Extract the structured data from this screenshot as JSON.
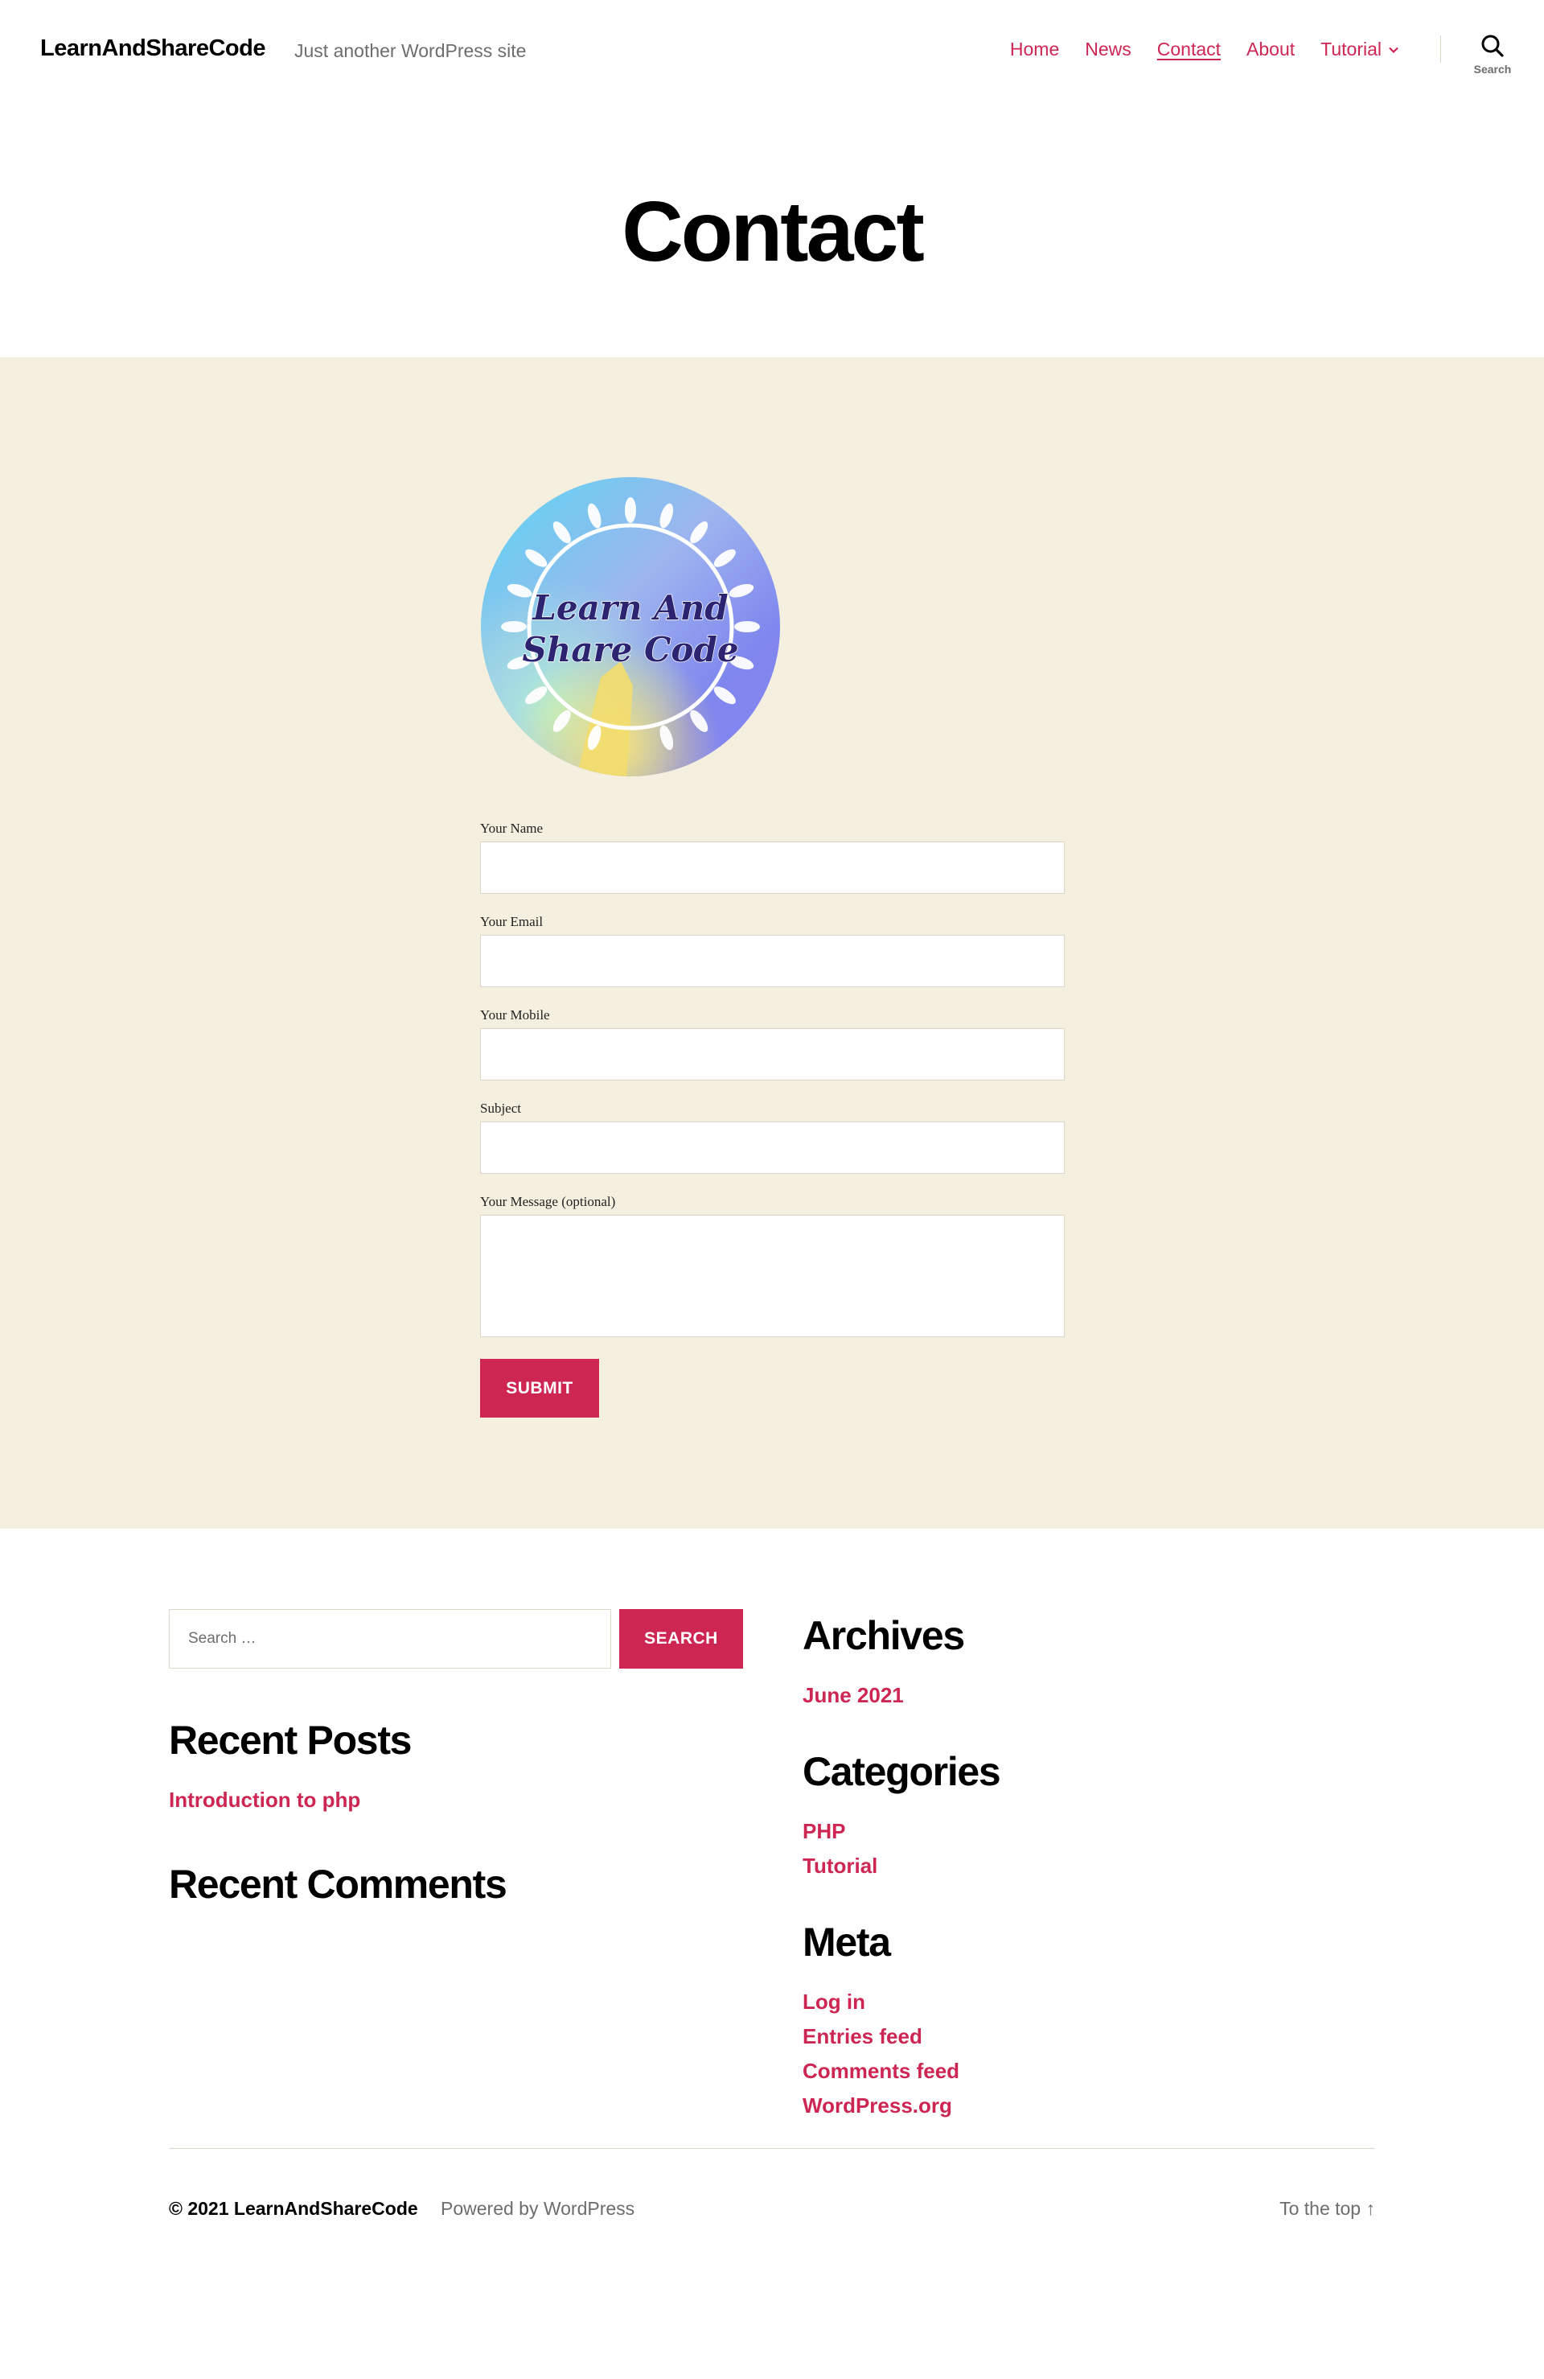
{
  "header": {
    "site_title": "LearnAndShareCode",
    "tagline": "Just another WordPress site",
    "nav": [
      {
        "label": "Home"
      },
      {
        "label": "News"
      },
      {
        "label": "Contact",
        "current": true
      },
      {
        "label": "About"
      },
      {
        "label": "Tutorial",
        "has_submenu": true
      }
    ],
    "search_label": "Search"
  },
  "page": {
    "title": "Contact"
  },
  "logo": {
    "text_line1": "Learn And",
    "text_line2": "Share Code"
  },
  "form": {
    "fields": [
      {
        "label": "Your Name",
        "value": ""
      },
      {
        "label": "Your Email",
        "value": ""
      },
      {
        "label": "Your Mobile",
        "value": ""
      },
      {
        "label": "Subject",
        "value": ""
      }
    ],
    "message_label": "Your Message (optional)",
    "message_value": "",
    "submit_label": "SUBMIT"
  },
  "widgets": {
    "search": {
      "placeholder": "Search …",
      "button_label": "SEARCH"
    },
    "recent_posts": {
      "title": "Recent Posts",
      "items": [
        "Introduction to php"
      ]
    },
    "recent_comments": {
      "title": "Recent Comments"
    },
    "archives": {
      "title": "Archives",
      "items": [
        "June 2021"
      ]
    },
    "categories": {
      "title": "Categories",
      "items": [
        "PHP",
        "Tutorial"
      ]
    },
    "meta": {
      "title": "Meta",
      "items": [
        "Log in",
        "Entries feed",
        "Comments feed",
        "WordPress.org"
      ]
    }
  },
  "footer": {
    "copyright": "© 2021 LearnAndShareCode",
    "powered_by": "Powered by WordPress",
    "to_top": "To the top ↑"
  },
  "colors": {
    "accent": "#cd2653",
    "content_bg": "#f5efe0",
    "muted_text": "#6d6d6d"
  }
}
